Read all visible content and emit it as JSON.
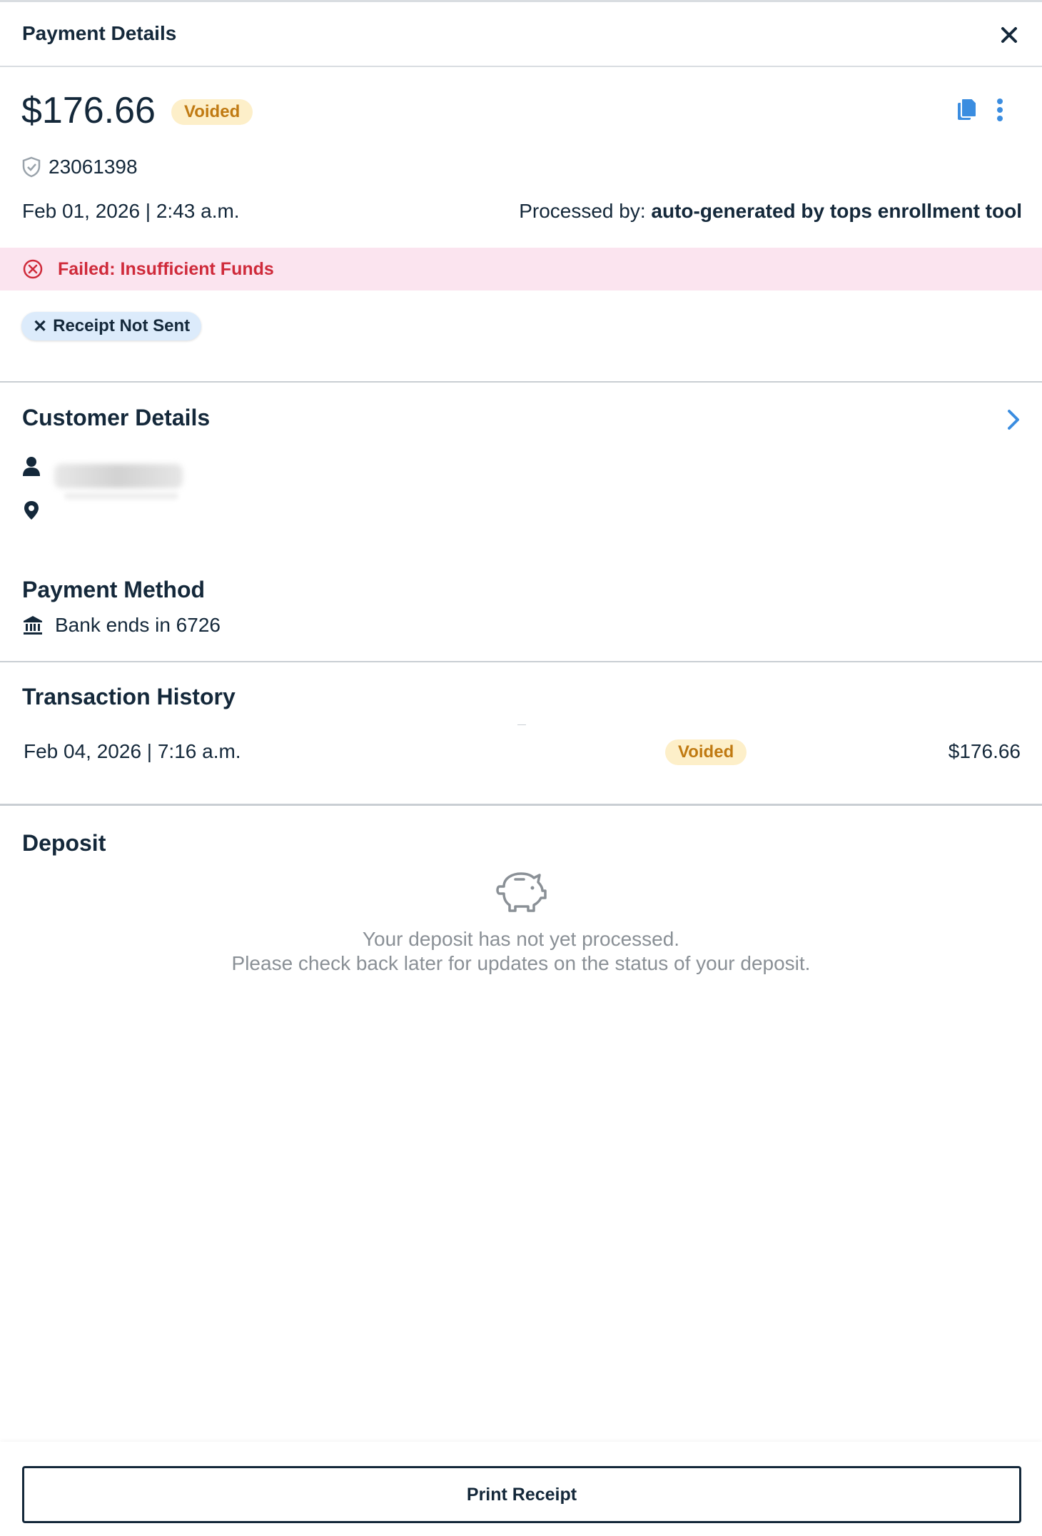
{
  "header": {
    "title": "Payment Details"
  },
  "payment": {
    "amount": "$176.66",
    "status": "Voided",
    "transaction_id": "23061398",
    "date": "Feb 01, 2026 | 2:43 a.m.",
    "processed_label": "Processed by: ",
    "processed_by": "auto-generated by tops enrollment tool",
    "failure": "Failed: Insufficient Funds",
    "receipt_status": "Receipt Not Sent"
  },
  "customer": {
    "title": "Customer Details"
  },
  "payment_method": {
    "title": "Payment Method",
    "text": "Bank ends in 6726"
  },
  "history": {
    "title": "Transaction History",
    "rows": [
      {
        "date": "Feb 04, 2026 | 7:16 a.m.",
        "status": "Voided",
        "amount": "$176.66"
      }
    ]
  },
  "deposit": {
    "title": "Deposit",
    "line1": "Your deposit has not yet processed.",
    "line2": "Please check back later for updates on the status of your deposit."
  },
  "footer": {
    "print_label": "Print Receipt"
  },
  "colors": {
    "accent_blue": "#3b8de0",
    "voided_bg": "#fdefc9",
    "voided_text": "#c07a12",
    "error_red": "#cf2a3a",
    "error_bg": "#fbe4ef",
    "chip_bg": "#dcebfb"
  },
  "icons": {
    "close": "close-icon",
    "copy": "copy-icon",
    "more": "more-vertical-icon",
    "shield": "shield-check-icon",
    "error": "error-circle-icon",
    "chevron": "chevron-right-icon",
    "person": "person-icon",
    "location": "location-pin-icon",
    "bank": "bank-icon",
    "piggy": "piggy-bank-icon"
  }
}
